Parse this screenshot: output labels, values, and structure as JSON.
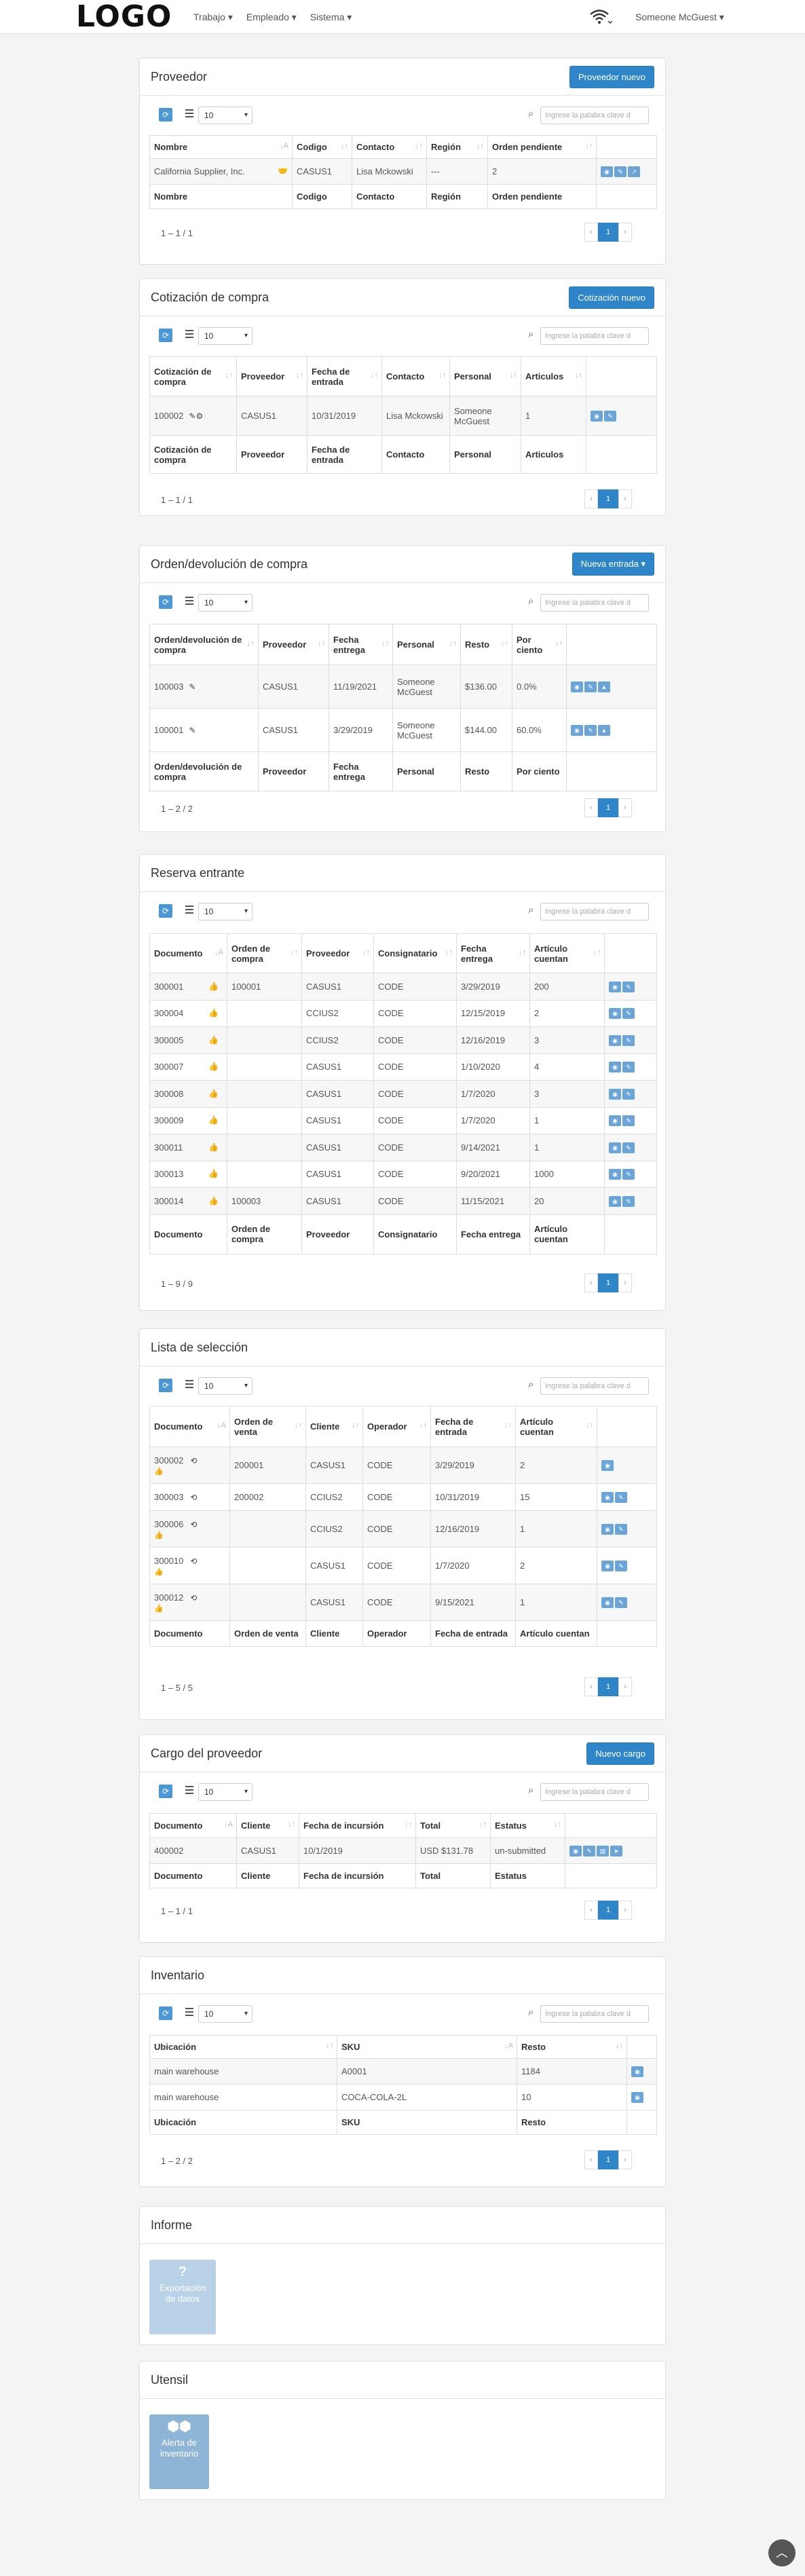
{
  "header": {
    "logo": "LOGO",
    "nav": [
      "Trabajo ▾",
      "Empleado ▾",
      "Sistema ▾"
    ],
    "user": "Someone McGuest ▾"
  },
  "common": {
    "page_size": "10",
    "search_placeholder": "Ingrese la palabra clave d",
    "prev": "‹",
    "next": "›",
    "page": "1"
  },
  "proveedor": {
    "title": "Proveedor",
    "button": "Proveedor nuevo",
    "columns": [
      "Nombre",
      "Codigo",
      "Contacto",
      "Región",
      "Orden pendiente"
    ],
    "rows": [
      [
        "California Supplier, Inc.",
        "CASUS1",
        "Lisa Mckowski",
        "---",
        "2"
      ]
    ],
    "count": "1 – 1 / 1"
  },
  "cotizacion": {
    "title": "Cotización de compra",
    "button": "Cotización nuevo",
    "columns": [
      "Cotización de compra",
      "Proveedor",
      "Fecha de entrada",
      "Contacto",
      "Personal",
      "Articulos"
    ],
    "rows": [
      [
        "100002",
        "CASUS1",
        "10/31/2019",
        "Lisa Mckowski",
        "Someone McGuest",
        "1"
      ]
    ],
    "count": "1 – 1 / 1"
  },
  "orden": {
    "title": "Orden/devolución de compra",
    "button": "Nueva entrada ▾",
    "columns": [
      "Orden/devolución de compra",
      "Proveedor",
      "Fecha entrega",
      "Personal",
      "Resto",
      "Por ciento"
    ],
    "rows": [
      [
        "100003",
        "CASUS1",
        "11/19/2021",
        "Someone McGuest",
        "$136.00",
        "0.0%"
      ],
      [
        "100001",
        "CASUS1",
        "3/29/2019",
        "Someone McGuest",
        "$144.00",
        "60.0%"
      ]
    ],
    "count": "1 – 2 / 2"
  },
  "reserva": {
    "title": "Reserva entrante",
    "columns": [
      "Documento",
      "Orden de compra",
      "Proveedor",
      "Consignatario",
      "Fecha entrega",
      "Artículo cuentan"
    ],
    "rows": [
      [
        "300001",
        "100001",
        "CASUS1",
        "CODE",
        "3/29/2019",
        "200"
      ],
      [
        "300004",
        "",
        "CCIUS2",
        "CODE",
        "12/15/2019",
        "2"
      ],
      [
        "300005",
        "",
        "CCIUS2",
        "CODE",
        "12/16/2019",
        "3"
      ],
      [
        "300007",
        "",
        "CASUS1",
        "CODE",
        "1/10/2020",
        "4"
      ],
      [
        "300008",
        "",
        "CASUS1",
        "CODE",
        "1/7/2020",
        "3"
      ],
      [
        "300009",
        "",
        "CASUS1",
        "CODE",
        "1/7/2020",
        "1"
      ],
      [
        "300011",
        "",
        "CASUS1",
        "CODE",
        "9/14/2021",
        "1"
      ],
      [
        "300013",
        "",
        "CASUS1",
        "CODE",
        "9/20/2021",
        "1000"
      ],
      [
        "300014",
        "100003",
        "CASUS1",
        "CODE",
        "11/15/2021",
        "20"
      ]
    ],
    "count": "1 – 9 / 9"
  },
  "lista": {
    "title": "Lista de selección",
    "columns": [
      "Documento",
      "Orden de venta",
      "Cliente",
      "Operador",
      "Fecha de entrada",
      "Artículo cuentan"
    ],
    "footer": [
      "Documento",
      "Orden de venta",
      "Cliente",
      "Operador",
      "Fecha de entrada",
      "Artículo cuentan"
    ],
    "rows": [
      [
        "300002",
        "200001",
        "CASUS1",
        "CODE",
        "3/29/2019",
        "2"
      ],
      [
        "300003",
        "200002",
        "CCIUS2",
        "CODE",
        "10/31/2019",
        "15"
      ],
      [
        "300006",
        "",
        "CCIUS2",
        "CODE",
        "12/16/2019",
        "1"
      ],
      [
        "300010",
        "",
        "CASUS1",
        "CODE",
        "1/7/2020",
        "2"
      ],
      [
        "300012",
        "",
        "CASUS1",
        "CODE",
        "9/15/2021",
        "1"
      ]
    ],
    "count": "1 – 5 / 5"
  },
  "cargo": {
    "title": "Cargo del proveedor",
    "button": "Nuevo cargo",
    "columns": [
      "Documento",
      "Cliente",
      "Fecha de incursión",
      "Total",
      "Estatus"
    ],
    "rows": [
      [
        "400002",
        "CASUS1",
        "10/1/2019",
        "USD $131.78",
        "un-submitted"
      ]
    ],
    "count": "1 – 1 / 1"
  },
  "inventario": {
    "title": "Inventario",
    "columns": [
      "Ubicación",
      "SKU",
      "Resto"
    ],
    "rows": [
      [
        "main warehouse",
        "A0001",
        "1184"
      ],
      [
        "main warehouse",
        "COCA-COLA-2L",
        "10"
      ]
    ],
    "count": "1 – 2 / 2"
  },
  "informe": {
    "title": "Informe",
    "tile": "Exportación de datos"
  },
  "utensil": {
    "title": "Utensil",
    "tile": "Alerta de inventario"
  }
}
